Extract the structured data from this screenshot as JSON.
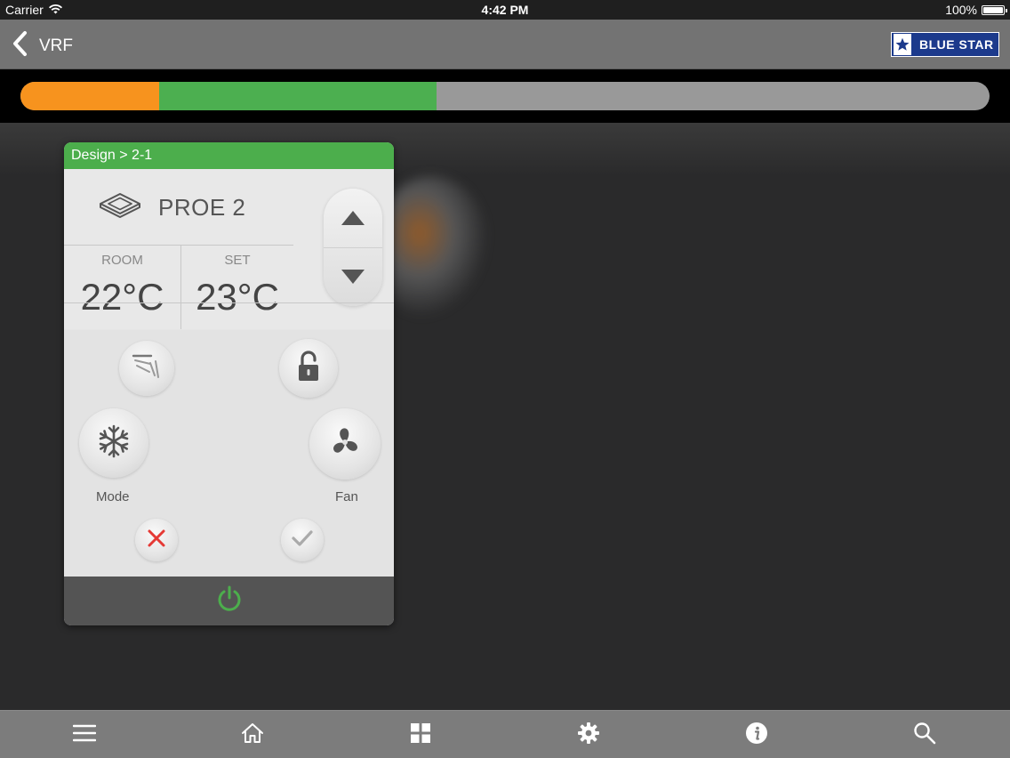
{
  "status_bar": {
    "carrier": "Carrier",
    "time": "4:42 PM",
    "battery": "100%"
  },
  "nav": {
    "back_icon": "chevron-left-icon",
    "title": "VRF",
    "logo_text": "BLUE STAR"
  },
  "progress": {
    "segments": [
      {
        "color": "#f7931e",
        "fraction": 0.143
      },
      {
        "color": "#4caf50",
        "fraction": 0.286
      },
      {
        "color": "#999999",
        "fraction": 0.571
      }
    ]
  },
  "card": {
    "breadcrumb": "Design > 2-1",
    "unit_icon": "cassette-ac-icon",
    "unit_name": "PROE 2",
    "room_label": "ROOM",
    "room_value": "22°C",
    "set_label": "SET",
    "set_value": "23°C",
    "controls": {
      "swing_icon": "swing-icon",
      "lock_icon": "unlocked-icon",
      "mode_icon": "snowflake-icon",
      "mode_label": "Mode",
      "fan_icon": "fan-icon",
      "fan_label": "Fan",
      "cancel_icon": "close-icon",
      "ok_icon": "check-icon",
      "power_icon": "power-icon"
    },
    "colors": {
      "header": "#4cae4c",
      "power": "#4cae4c",
      "cancel": "#e53935"
    }
  },
  "tab_bar": {
    "items": [
      {
        "icon": "menu-icon"
      },
      {
        "icon": "home-icon"
      },
      {
        "icon": "grid-icon"
      },
      {
        "icon": "gear-icon"
      },
      {
        "icon": "info-icon"
      },
      {
        "icon": "search-icon"
      }
    ]
  }
}
